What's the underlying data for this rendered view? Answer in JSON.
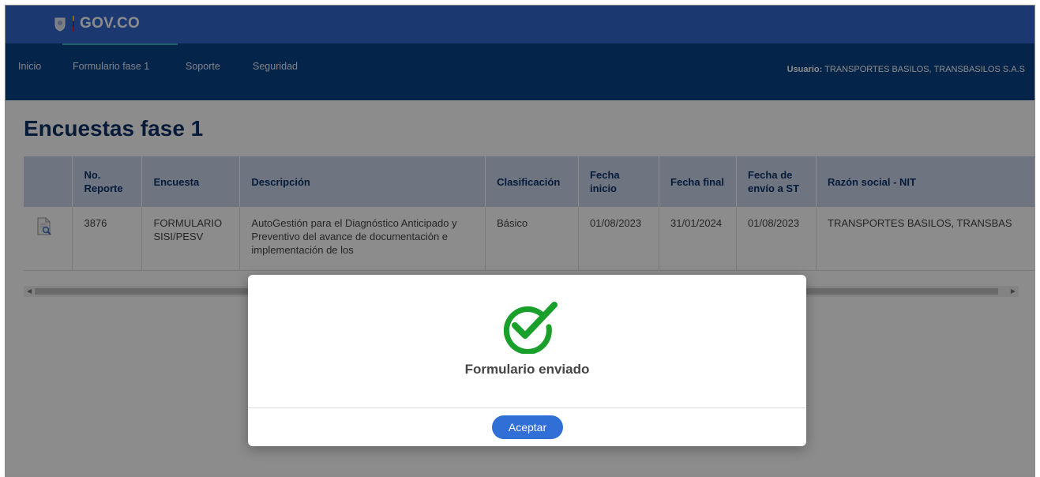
{
  "gov": {
    "brand": "GOV.CO"
  },
  "nav": {
    "items": [
      "Inicio",
      "Formulario fase 1",
      "Soporte",
      "Seguridad"
    ],
    "user_label": "Usuario:",
    "user_value": "TRANSPORTES BASILOS, TRANSBASILOS S.A.S"
  },
  "page": {
    "title": "Encuestas fase 1"
  },
  "table": {
    "headers": [
      "",
      "No. Reporte",
      "Encuesta",
      "Descripción",
      "Clasificación",
      "Fecha inicio",
      "Fecha final",
      "Fecha de envío a ST",
      "Razón social - NIT"
    ],
    "rows": [
      {
        "icon": "document-search-icon",
        "report": "3876",
        "survey": "FORMULARIO SISI/PESV",
        "description": "AutoGestión para el Diagnóstico Anticipado y Preventivo del avance de documentación e implementación de los",
        "classification": "Básico",
        "start": "01/08/2023",
        "end": "31/01/2024",
        "sent": "01/08/2023",
        "company": "TRANSPORTES BASILOS, TRANSBAS"
      }
    ]
  },
  "modal": {
    "icon": "check-circle-icon",
    "title": "Formulario enviado",
    "accept_label": "Aceptar"
  },
  "colors": {
    "gov_blue": "#3366cc",
    "nav_blue": "#0a4287",
    "title_blue": "#0b3068",
    "success_green": "#19a02a",
    "button_blue": "#2f6fd6"
  }
}
